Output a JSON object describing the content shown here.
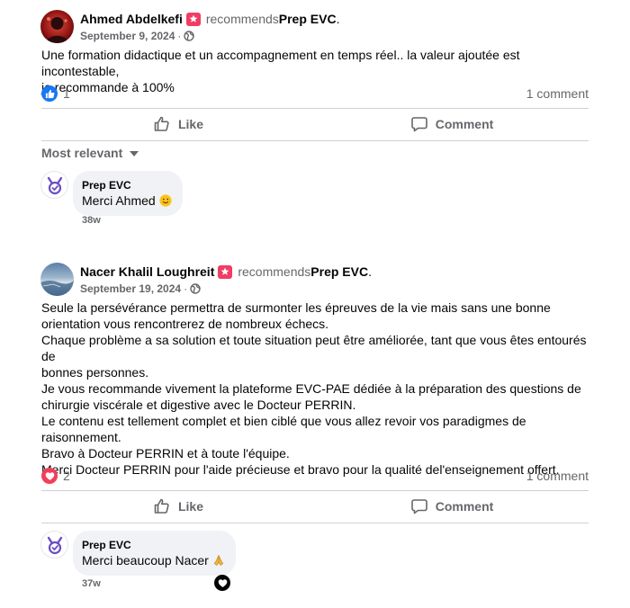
{
  "posts": [
    {
      "author": "Ahmed Abdelkefi",
      "recommends_label": "recommends",
      "page": "Prep EVC",
      "period": ".",
      "date": "September 9, 2024",
      "separator": "·",
      "privacy_icon": "globe-icon",
      "body": [
        "Une formation didactique et un accompagnement en temps réel.. la valeur ajoutée est incontestable,",
        "je recommande à 100%"
      ],
      "reaction_type": "like",
      "reaction_count": "1",
      "comment_count": "1 comment",
      "actions": {
        "like": "Like",
        "comment": "Comment"
      },
      "sort_label": "Most relevant",
      "comment": {
        "author": "Prep EVC",
        "text": "Merci Ahmed",
        "emoji": "slightly-smiling-face",
        "time": "38w"
      }
    },
    {
      "author": "Nacer Khalil Loughreit",
      "recommends_label": "recommends",
      "page": "Prep EVC",
      "period": ".",
      "date": "September 19, 2024",
      "separator": "·",
      "privacy_icon": "globe-icon",
      "body": [
        "Seule la persévérance permettra de surmonter les épreuves de la vie mais  sans une bonne",
        "orientation vous rencontrerez de nombreux échecs.",
        "Chaque problème a sa solution et toute situation peut être améliorée, tant que vous êtes entourés de",
        "bonnes personnes.",
        "Je vous recommande vivement la plateforme EVC-PAE dédiée à la préparation des questions de",
        "chirurgie viscérale et digestive avec le Docteur PERRIN.",
        "Le contenu est tellement complet et bien ciblé que vous allez revoir vos paradigmes de",
        "raisonnement.",
        "Bravo à Docteur PERRIN et à toute l'équipe.",
        "Merci Docteur PERRIN pour l'aide précieuse et bravo pour la qualité del'enseignement offert."
      ],
      "reaction_type": "love",
      "reaction_count": "2",
      "comment_count": "1 comment",
      "actions": {
        "like": "Like",
        "comment": "Comment"
      },
      "comment": {
        "author": "Prep EVC",
        "text": "Merci beaucoup Nacer",
        "emoji": "folded-hands",
        "time": "37w"
      }
    }
  ],
  "colors": {
    "text_primary": "#050505",
    "text_secondary": "#65676b",
    "like_blue": "#1877f2",
    "love_red": "#f33e58",
    "recommend_badge": "#f03d64",
    "bubble_bg": "#f0f2f5",
    "divider": "#ced0d4"
  }
}
